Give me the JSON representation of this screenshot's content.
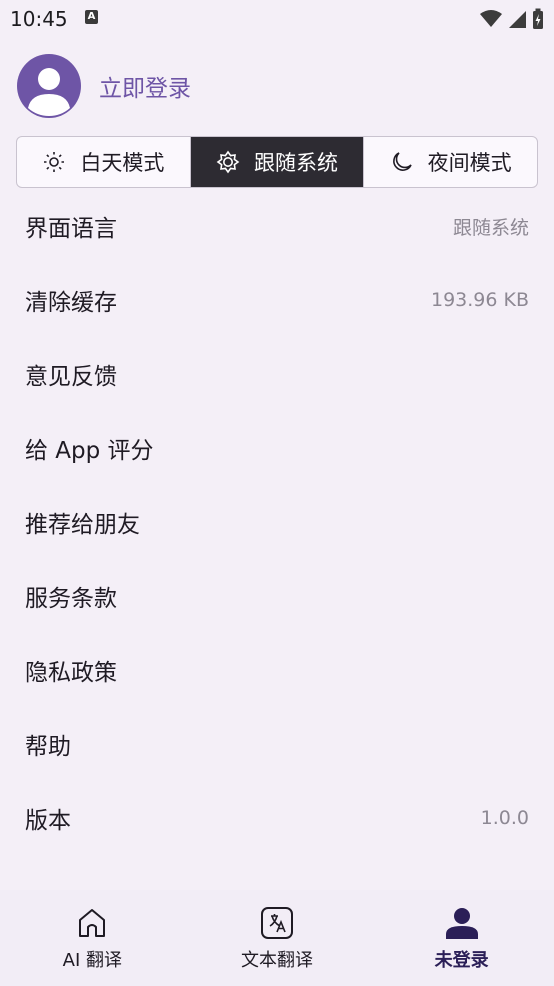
{
  "status_bar": {
    "time": "10:45",
    "notification_icon": "A"
  },
  "profile": {
    "login_label": "立即登录"
  },
  "theme": {
    "options": [
      {
        "label": "白天模式",
        "icon": "sun-icon"
      },
      {
        "label": "跟随系统",
        "icon": "system-brightness-icon"
      },
      {
        "label": "夜间模式",
        "icon": "moon-icon"
      }
    ],
    "selected": "跟随系统"
  },
  "settings": [
    {
      "label": "界面语言",
      "value": "跟随系统"
    },
    {
      "label": "清除缓存",
      "value": "193.96 KB"
    },
    {
      "label": "意见反馈",
      "value": ""
    },
    {
      "label": "给 App 评分",
      "value": ""
    },
    {
      "label": "推荐给朋友",
      "value": ""
    },
    {
      "label": "服务条款",
      "value": ""
    },
    {
      "label": "隐私政策",
      "value": ""
    },
    {
      "label": "帮助",
      "value": ""
    },
    {
      "label": "版本",
      "value": "1.0.0"
    }
  ],
  "bottom_nav": [
    {
      "label": "AI 翻译",
      "icon": "home-icon"
    },
    {
      "label": "文本翻译",
      "icon": "translate-icon"
    },
    {
      "label": "未登录",
      "icon": "person-icon"
    }
  ],
  "colors": {
    "accent": "#6e55a6",
    "background": "#f4eff7",
    "selected_segment": "#2d2b32",
    "secondary_text": "#8d8893"
  }
}
